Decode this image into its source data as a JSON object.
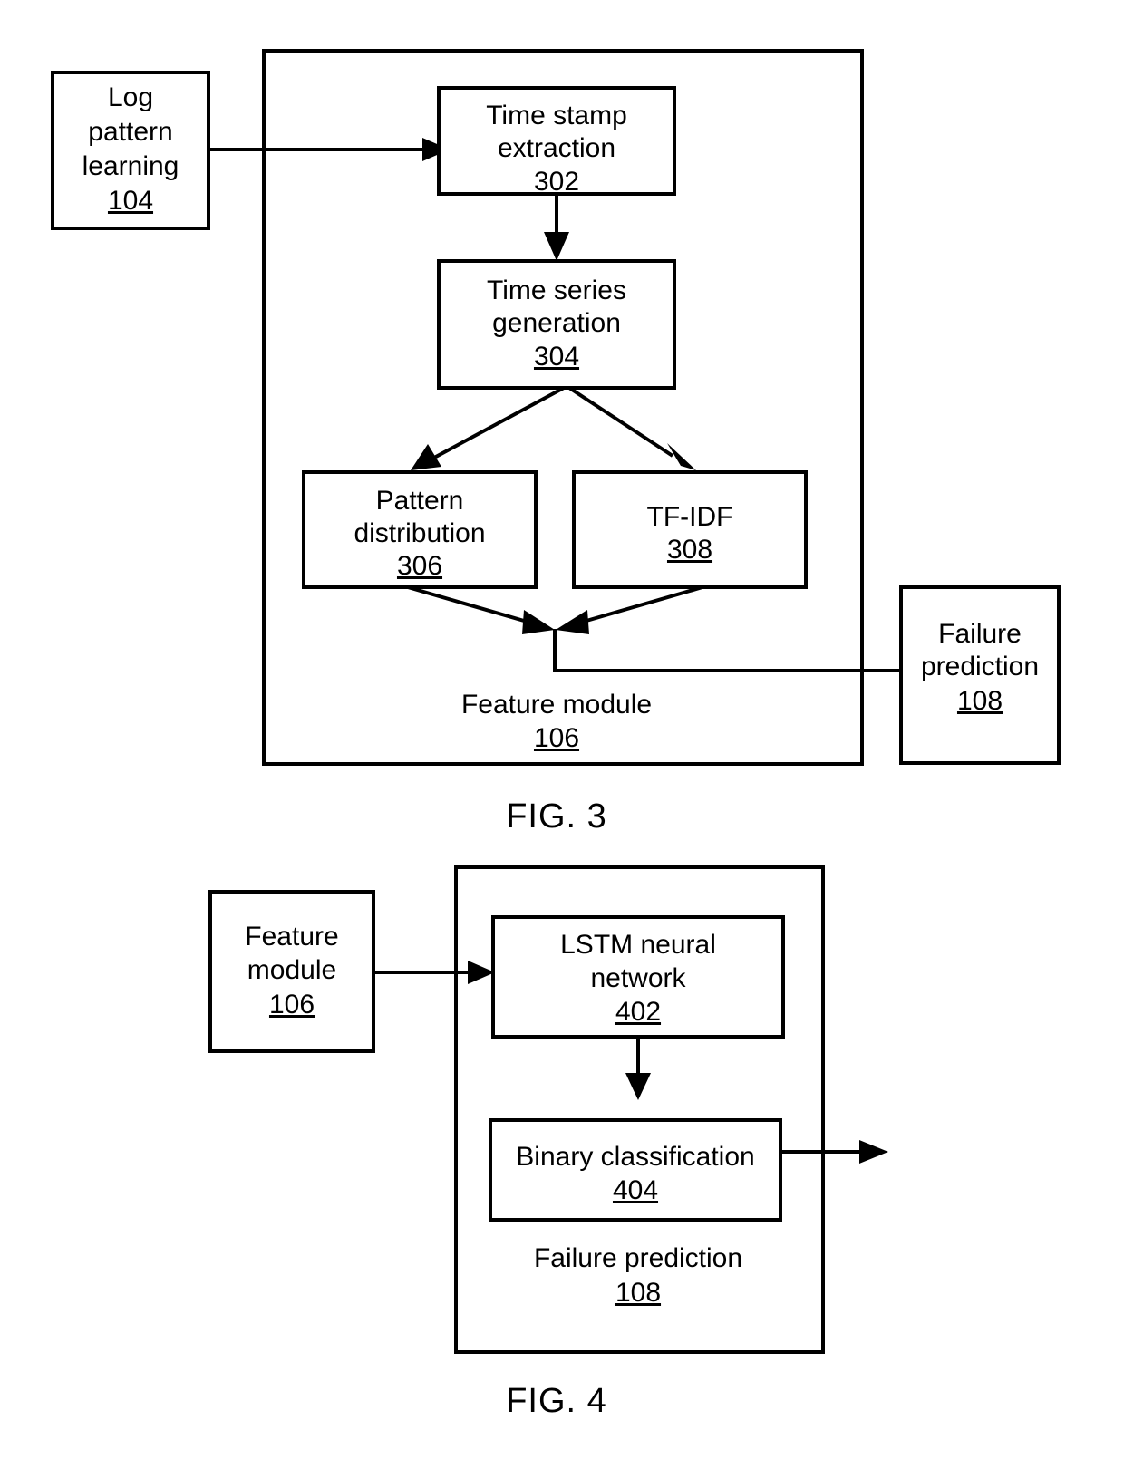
{
  "document": {
    "type": "patent-drawing-sheet",
    "figures": [
      {
        "id": "fig3",
        "caption": "FIG. 3",
        "container": {
          "label": "Feature module",
          "ref": "106"
        },
        "external_boxes": [
          {
            "label_line1": "Log",
            "label_line2": "pattern",
            "label_line3": "learning",
            "ref": "104"
          },
          {
            "label_line1": "Failure",
            "label_line2": "prediction",
            "label_line3": "",
            "ref": "108"
          }
        ],
        "inner_boxes": [
          {
            "label_line1": "Time stamp",
            "label_line2": "extraction",
            "ref": "302"
          },
          {
            "label_line1": "Time series",
            "label_line2": "generation",
            "ref": "304"
          },
          {
            "label_line1": "Pattern",
            "label_line2": "distribution",
            "ref": "306"
          },
          {
            "label_line1": "TF-IDF",
            "label_line2": "",
            "ref": "308"
          }
        ]
      },
      {
        "id": "fig4",
        "caption": "FIG. 4",
        "container": {
          "label": "Failure prediction",
          "ref": "108"
        },
        "external_boxes": [
          {
            "label_line1": "Feature",
            "label_line2": "module",
            "label_line3": "",
            "ref": "106"
          }
        ],
        "inner_boxes": [
          {
            "label_line1": "LSTM neural",
            "label_line2": "network",
            "ref": "402"
          },
          {
            "label_line1": "Binary classification",
            "label_line2": "",
            "ref": "404"
          }
        ]
      }
    ]
  },
  "colors": {
    "ink": "#000000",
    "paper": "#ffffff"
  }
}
